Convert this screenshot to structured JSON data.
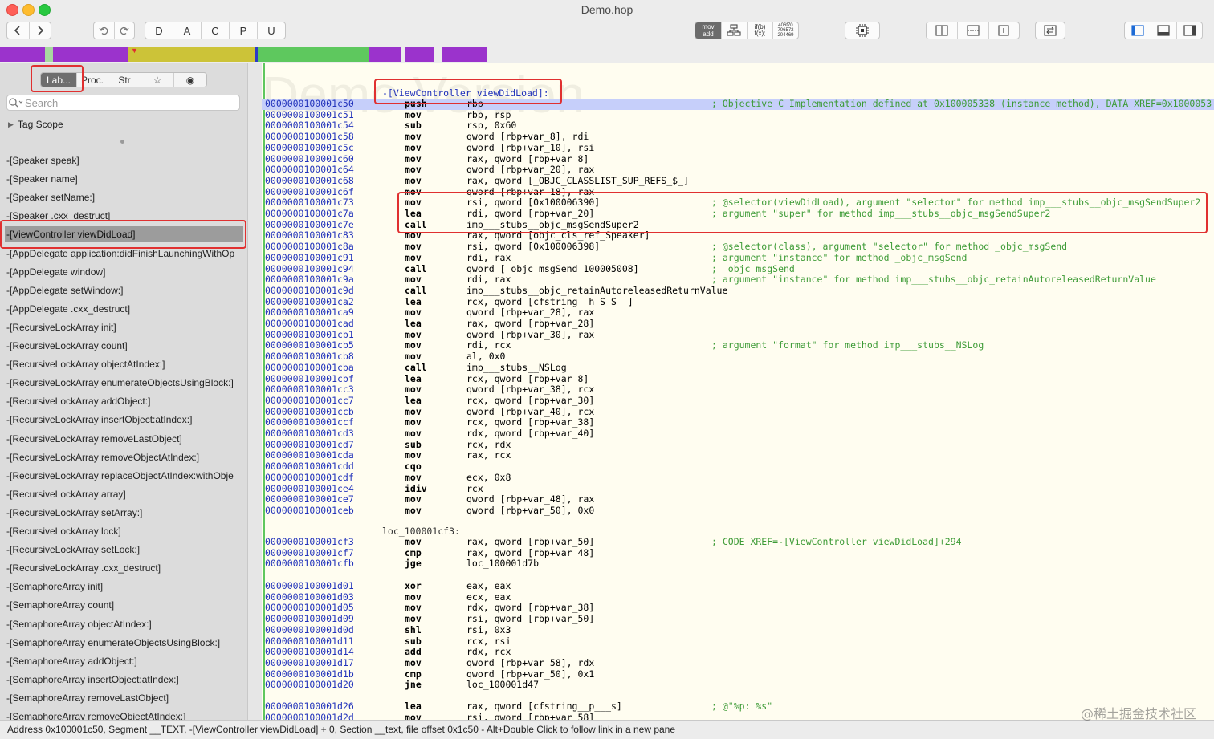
{
  "window": {
    "title": "Demo.hop"
  },
  "toolbar": {
    "letters": [
      "D",
      "A",
      "C",
      "P",
      "U"
    ],
    "modes": {
      "mov_add": "mov\nadd",
      "ifb": "if(b)\nf(x);",
      "hex": "406f70\n706572\n204469"
    }
  },
  "colors": {
    "accent_purple": "#9b33cc",
    "nav_yellow": "#ccc338",
    "nav_green": "#5ec85e",
    "selection_red": "#e03030",
    "code_bg": "#fffdf0"
  },
  "sidebar": {
    "tabs": [
      "Lab...",
      "Proc.",
      "Str",
      "☆",
      "◉"
    ],
    "search_placeholder": "Search",
    "tag_scope": "Tag Scope",
    "items": [
      "-[Speaker speak]",
      "-[Speaker name]",
      "-[Speaker setName:]",
      "-[Speaker .cxx_destruct]",
      "-[ViewController viewDidLoad]",
      "-[AppDelegate application:didFinishLaunchingWithOp",
      "-[AppDelegate window]",
      "-[AppDelegate setWindow:]",
      "-[AppDelegate .cxx_destruct]",
      "-[RecursiveLockArray init]",
      "-[RecursiveLockArray count]",
      "-[RecursiveLockArray objectAtIndex:]",
      "-[RecursiveLockArray enumerateObjectsUsingBlock:]",
      "-[RecursiveLockArray addObject:]",
      "-[RecursiveLockArray insertObject:atIndex:]",
      "-[RecursiveLockArray removeLastObject]",
      "-[RecursiveLockArray removeObjectAtIndex:]",
      "-[RecursiveLockArray replaceObjectAtIndex:withObje",
      "-[RecursiveLockArray array]",
      "-[RecursiveLockArray setArray:]",
      "-[RecursiveLockArray lock]",
      "-[RecursiveLockArray setLock:]",
      "-[RecursiveLockArray .cxx_destruct]",
      "-[SemaphoreArray init]",
      "-[SemaphoreArray count]",
      "-[SemaphoreArray objectAtIndex:]",
      "-[SemaphoreArray enumerateObjectsUsingBlock:]",
      "-[SemaphoreArray addObject:]",
      "-[SemaphoreArray insertObject:atIndex:]",
      "-[SemaphoreArray removeLastObject]",
      "-[SemaphoreArray removeObjectAtIndex:]"
    ],
    "selected_index": 4
  },
  "code": {
    "watermark": "Demo Version",
    "function_label": "-[ViewController viewDidLoad]:",
    "loc_label_1": "loc_100001cf3:",
    "block1": [
      [
        "0000000100001c50",
        "push",
        "rbp",
        "; Objective C Implementation defined at 0x100005338 (instance method), DATA XREF=0x1000053"
      ],
      [
        "0000000100001c51",
        "mov",
        "rbp, rsp",
        ""
      ],
      [
        "0000000100001c54",
        "sub",
        "rsp, 0x60",
        ""
      ],
      [
        "0000000100001c58",
        "mov",
        "qword [rbp+var_8], rdi",
        ""
      ],
      [
        "0000000100001c5c",
        "mov",
        "qword [rbp+var_10], rsi",
        ""
      ],
      [
        "0000000100001c60",
        "mov",
        "rax, qword [rbp+var_8]",
        ""
      ],
      [
        "0000000100001c64",
        "mov",
        "qword [rbp+var_20], rax",
        ""
      ],
      [
        "0000000100001c68",
        "mov",
        "rax, qword [_OBJC_CLASSLIST_SUP_REFS_$_]",
        ""
      ],
      [
        "0000000100001c6f",
        "mov",
        "qword [rbp+var_18], rax",
        ""
      ],
      [
        "0000000100001c73",
        "mov",
        "rsi, qword [0x100006390]",
        "; @selector(viewDidLoad), argument \"selector\" for method imp___stubs__objc_msgSendSuper2"
      ],
      [
        "0000000100001c7a",
        "lea",
        "rdi, qword [rbp+var_20]",
        "; argument \"super\" for method imp___stubs__objc_msgSendSuper2"
      ],
      [
        "0000000100001c7e",
        "call",
        "imp___stubs__objc_msgSendSuper2",
        ""
      ],
      [
        "0000000100001c83",
        "mov",
        "rax, qword [objc_cls_ref_Speaker]",
        ""
      ],
      [
        "0000000100001c8a",
        "mov",
        "rsi, qword [0x100006398]",
        "; @selector(class), argument \"selector\" for method _objc_msgSend"
      ],
      [
        "0000000100001c91",
        "mov",
        "rdi, rax",
        "; argument \"instance\" for method _objc_msgSend"
      ],
      [
        "0000000100001c94",
        "call",
        "qword [_objc_msgSend_100005008]",
        "; _objc_msgSend"
      ],
      [
        "0000000100001c9a",
        "mov",
        "rdi, rax",
        "; argument \"instance\" for method imp___stubs__objc_retainAutoreleasedReturnValue"
      ],
      [
        "0000000100001c9d",
        "call",
        "imp___stubs__objc_retainAutoreleasedReturnValue",
        ""
      ],
      [
        "0000000100001ca2",
        "lea",
        "rcx, qword [cfstring__h_S_S__]",
        ""
      ],
      [
        "0000000100001ca9",
        "mov",
        "qword [rbp+var_28], rax",
        ""
      ],
      [
        "0000000100001cad",
        "lea",
        "rax, qword [rbp+var_28]",
        ""
      ],
      [
        "0000000100001cb1",
        "mov",
        "qword [rbp+var_30], rax",
        ""
      ],
      [
        "0000000100001cb5",
        "mov",
        "rdi, rcx",
        "; argument \"format\" for method imp___stubs__NSLog"
      ],
      [
        "0000000100001cb8",
        "mov",
        "al, 0x0",
        ""
      ],
      [
        "0000000100001cba",
        "call",
        "imp___stubs__NSLog",
        ""
      ],
      [
        "0000000100001cbf",
        "lea",
        "rcx, qword [rbp+var_8]",
        ""
      ],
      [
        "0000000100001cc3",
        "mov",
        "qword [rbp+var_38], rcx",
        ""
      ],
      [
        "0000000100001cc7",
        "lea",
        "rcx, qword [rbp+var_30]",
        ""
      ],
      [
        "0000000100001ccb",
        "mov",
        "qword [rbp+var_40], rcx",
        ""
      ],
      [
        "0000000100001ccf",
        "mov",
        "rcx, qword [rbp+var_38]",
        ""
      ],
      [
        "0000000100001cd3",
        "mov",
        "rdx, qword [rbp+var_40]",
        ""
      ],
      [
        "0000000100001cd7",
        "sub",
        "rcx, rdx",
        ""
      ],
      [
        "0000000100001cda",
        "mov",
        "rax, rcx",
        ""
      ],
      [
        "0000000100001cdd",
        "cqo",
        "",
        ""
      ],
      [
        "0000000100001cdf",
        "mov",
        "ecx, 0x8",
        ""
      ],
      [
        "0000000100001ce4",
        "idiv",
        "rcx",
        ""
      ],
      [
        "0000000100001ce7",
        "mov",
        "qword [rbp+var_48], rax",
        ""
      ],
      [
        "0000000100001ceb",
        "mov",
        "qword [rbp+var_50], 0x0",
        ""
      ]
    ],
    "block2": [
      [
        "0000000100001cf3",
        "mov",
        "rax, qword [rbp+var_50]",
        "; CODE XREF=-[ViewController viewDidLoad]+294"
      ],
      [
        "0000000100001cf7",
        "cmp",
        "rax, qword [rbp+var_48]",
        ""
      ],
      [
        "0000000100001cfb",
        "jge",
        "loc_100001d7b",
        ""
      ]
    ],
    "block3": [
      [
        "0000000100001d01",
        "xor",
        "eax, eax",
        ""
      ],
      [
        "0000000100001d03",
        "mov",
        "ecx, eax",
        ""
      ],
      [
        "0000000100001d05",
        "mov",
        "rdx, qword [rbp+var_38]",
        ""
      ],
      [
        "0000000100001d09",
        "mov",
        "rsi, qword [rbp+var_50]",
        ""
      ],
      [
        "0000000100001d0d",
        "shl",
        "rsi, 0x3",
        ""
      ],
      [
        "0000000100001d11",
        "sub",
        "rcx, rsi",
        ""
      ],
      [
        "0000000100001d14",
        "add",
        "rdx, rcx",
        ""
      ],
      [
        "0000000100001d17",
        "mov",
        "qword [rbp+var_58], rdx",
        ""
      ],
      [
        "0000000100001d1b",
        "cmp",
        "qword [rbp+var_50], 0x1",
        ""
      ],
      [
        "0000000100001d20",
        "jne",
        "loc_100001d47",
        ""
      ]
    ],
    "block4": [
      [
        "0000000100001d26",
        "lea",
        "rax, qword [cfstring__p___s]",
        "; @\"%p: %s\""
      ],
      [
        "0000000100001d2d",
        "mov",
        "rsi, qword [rbp+var_58]",
        ""
      ]
    ]
  },
  "status": {
    "text": "Address 0x100001c50, Segment __TEXT, -[ViewController viewDidLoad] + 0, Section __text, file offset 0x1c50 - Alt+Double Click to follow link in a new pane",
    "watermark": "@稀土掘金技术社区"
  }
}
